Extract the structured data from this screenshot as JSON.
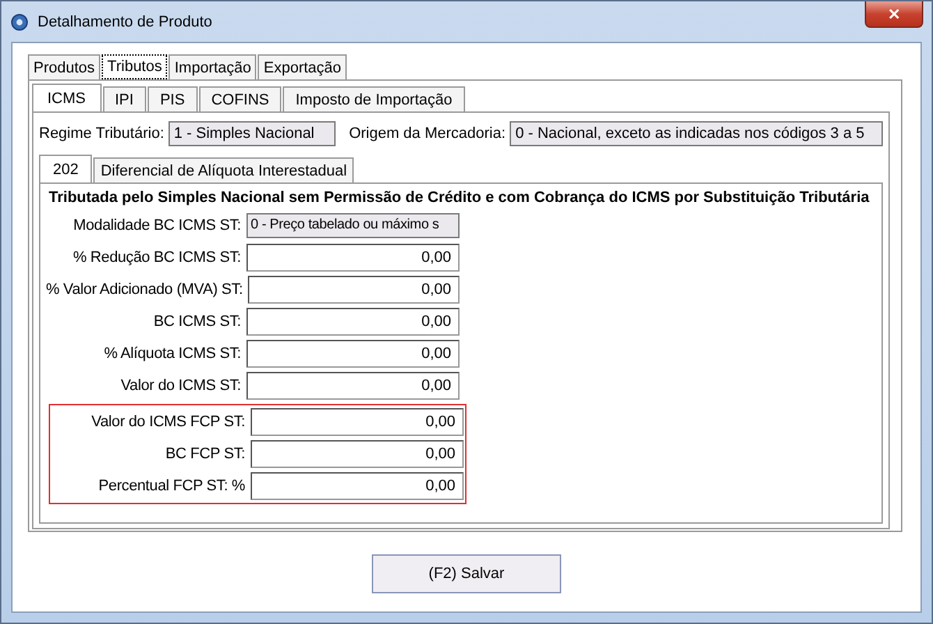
{
  "window": {
    "title": "Detalhamento de Produto",
    "close": "✕"
  },
  "main_tabs": [
    {
      "label": "Produtos",
      "selected": false
    },
    {
      "label": "Tributos",
      "selected": true
    },
    {
      "label": "Importação",
      "selected": false
    },
    {
      "label": "Exportação",
      "selected": false
    }
  ],
  "tax_tabs": [
    {
      "label": "ICMS",
      "selected": true
    },
    {
      "label": "IPI",
      "selected": false
    },
    {
      "label": "PIS",
      "selected": false
    },
    {
      "label": "COFINS",
      "selected": false
    },
    {
      "label": "Imposto de Importação",
      "selected": false
    }
  ],
  "regime": {
    "label": "Regime Tributário:",
    "value": "1 - Simples Nacional"
  },
  "origem": {
    "label": "Origem da Mercadoria:",
    "value": "0 - Nacional, exceto as indicadas nos códigos 3 a 5"
  },
  "icms_tabs": [
    {
      "label": "202",
      "selected": true
    },
    {
      "label": "Diferencial de Alíquota Interestadual",
      "selected": false
    }
  ],
  "heading": "Tributada pelo Simples Nacional sem Permissão de Crédito e com Cobrança do ICMS por Substituição Tributária",
  "fields": [
    {
      "label": "Modalidade BC ICMS ST:",
      "value": "0 - Preço tabelado ou máximo s",
      "kind": "select",
      "highlighted": false
    },
    {
      "label": "% Redução BC ICMS ST:",
      "value": "0,00",
      "kind": "number",
      "highlighted": false
    },
    {
      "label": "% Valor Adicionado (MVA) ST:",
      "value": "0,00",
      "kind": "number",
      "highlighted": false
    },
    {
      "label": "BC ICMS ST:",
      "value": "0,00",
      "kind": "number",
      "highlighted": false
    },
    {
      "label": "% Alíquota ICMS ST:",
      "value": "0,00",
      "kind": "number",
      "highlighted": false
    },
    {
      "label": "Valor do ICMS ST:",
      "value": "0,00",
      "kind": "number",
      "highlighted": false
    },
    {
      "label": "Valor do ICMS FCP ST:",
      "value": "0,00",
      "kind": "number",
      "highlighted": true
    },
    {
      "label": "BC FCP ST:",
      "value": "0,00",
      "kind": "number",
      "highlighted": true
    },
    {
      "label": "Percentual FCP ST: %",
      "value": "0,00",
      "kind": "number",
      "highlighted": true
    }
  ],
  "save_button": "(F2) Salvar"
}
